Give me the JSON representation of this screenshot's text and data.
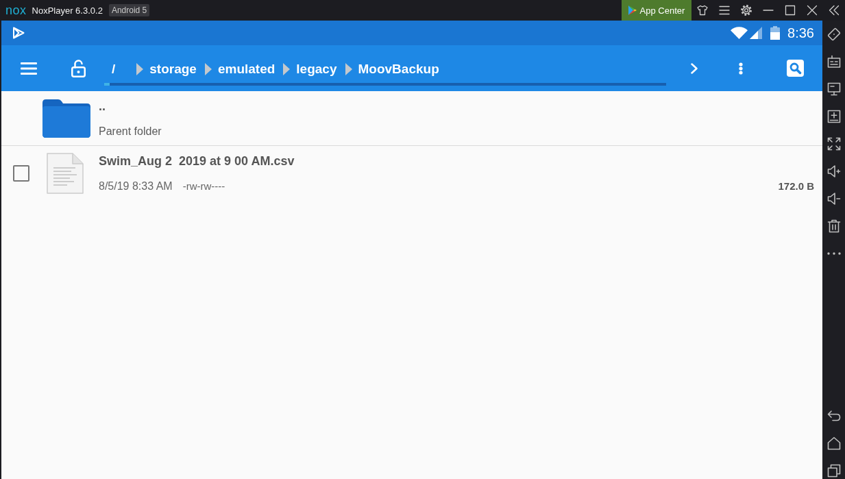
{
  "window": {
    "logo": "nox",
    "title": "NoxPlayer 6.3.0.2",
    "badge": "Android 5",
    "app_center": "App Center"
  },
  "status_bar": {
    "time": "8:36"
  },
  "toolbar": {
    "breadcrumb": [
      {
        "label": "/"
      },
      {
        "label": "storage"
      },
      {
        "label": "emulated"
      },
      {
        "label": "legacy"
      },
      {
        "label": "MoovBackup"
      }
    ]
  },
  "files": [
    {
      "kind": "parent",
      "name": "..",
      "detail": "Parent folder"
    },
    {
      "kind": "file",
      "name": "Swim_Aug 2  2019 at 9 00 AM.csv",
      "date": "8/5/19 8:33 AM",
      "permissions": "-rw-rw----",
      "size": "172.0 B",
      "checked": false
    }
  ]
}
